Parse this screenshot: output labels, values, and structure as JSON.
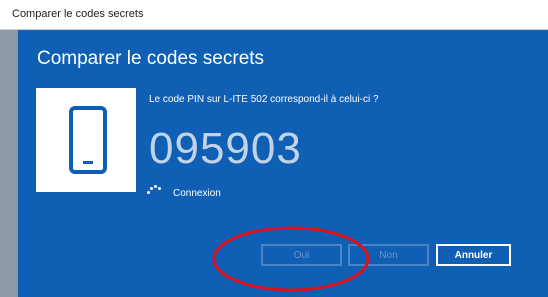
{
  "window": {
    "title": "Comparer le codes secrets"
  },
  "dialog": {
    "heading": "Comparer le codes secrets",
    "prompt": "Le code PIN sur L-ITE 502 correspond-il à celui-ci ?",
    "pin": "095903",
    "status": "Connexion",
    "device_icon": "smartphone-icon",
    "spinner_icon": "loading-spinner-icon"
  },
  "buttons": {
    "yes_label": "Oui",
    "no_label": "Non",
    "cancel_label": "Annuler"
  },
  "annotation": {
    "color": "#e0101a"
  },
  "colors": {
    "dialog_background": "#0f5fb4",
    "pin_text": "#c3d3e6"
  }
}
